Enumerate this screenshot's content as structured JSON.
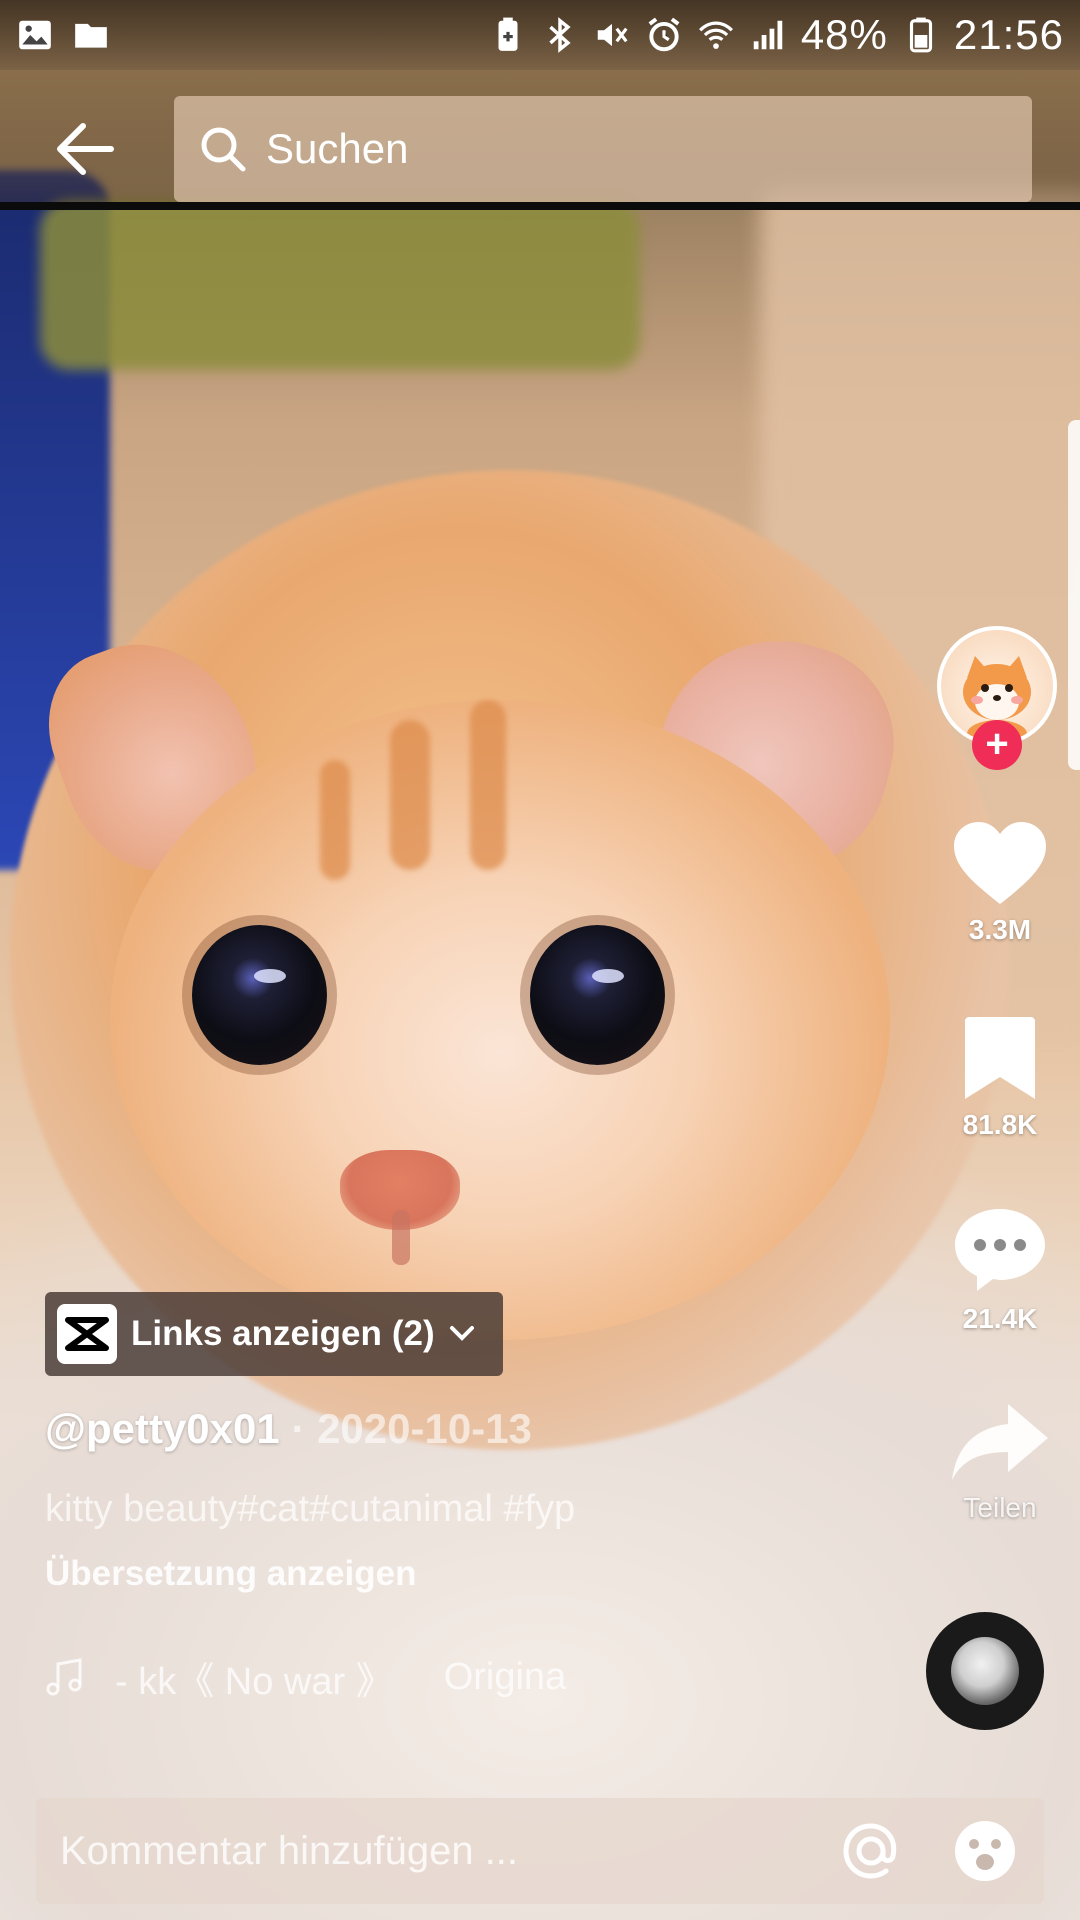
{
  "status_bar": {
    "battery": "48%",
    "time": "21:56",
    "left_icons": [
      "image-icon",
      "folder-icon"
    ],
    "right_icons": [
      "battery-saver-icon",
      "bluetooth-icon",
      "mute-icon",
      "alarm-icon",
      "wifi-icon",
      "signal-icon",
      "battery-icon"
    ]
  },
  "header": {
    "back_icon": "arrow-left-icon",
    "search_placeholder": "Suchen"
  },
  "actions": {
    "likes": "3.3M",
    "saves": "81.8K",
    "comments": "21.4K",
    "share_label": "Teilen"
  },
  "links": {
    "label": "Links anzeigen",
    "count": "(2)"
  },
  "post": {
    "username": "@petty0x01",
    "separator": "·",
    "date": "2020-10-13",
    "caption": "kitty beauty#cat#cutanimal #fyp",
    "translate": "Übersetzung anzeigen"
  },
  "music": {
    "track": "- kk《 No war 》",
    "origin": "Origina"
  },
  "comment": {
    "placeholder": "Kommentar hinzufügen ..."
  },
  "colors": {
    "follow_badge": "#ef2d57",
    "links_pill": "#46372f",
    "top_bar_divider": "#0b0b0b"
  }
}
